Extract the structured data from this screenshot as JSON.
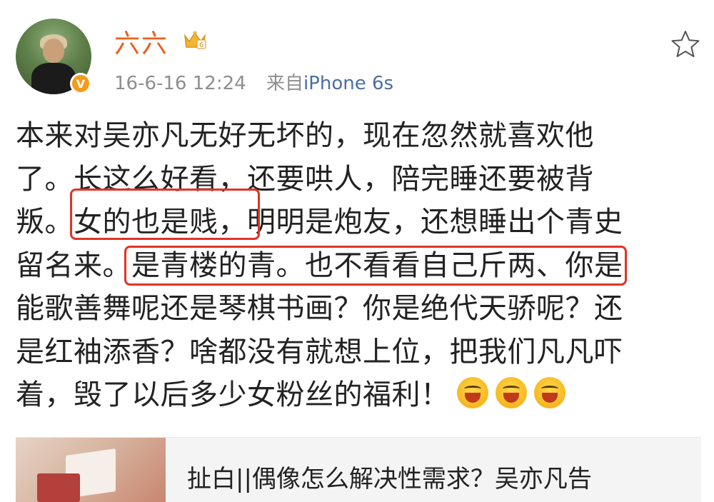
{
  "post_header": {
    "username": "六六",
    "timestamp": "16-6-16 12:24",
    "source_prefix": "来自",
    "device": "iPhone 6s",
    "verified_badge": "V",
    "crown_level": "6"
  },
  "post": {
    "lines": [
      "本来对吴亦凡无好无坏的，现在忽然就喜欢他",
      "了。长这么好看，还要哄人，陪完睡还要被背",
      "叛。女的也是贱，明明是炮友，还想睡出个青史",
      "留名来。是青楼的青。也不看看自己斤两、你是",
      "能歌善舞呢还是琴棋书画？你是绝代天骄呢？还",
      "是红袖添香？啥都没有就想上位，把我们凡凡吓",
      "着，毁了以后多少女粉丝的福利！"
    ],
    "emojis": [
      "laughing-emoji",
      "laughing-emoji",
      "laughing-emoji"
    ],
    "highlight_color": "#e03424"
  },
  "link_card": {
    "title": "扯白||偶像怎么解决性需求？吴亦凡告"
  },
  "colors": {
    "username": "#e8611f",
    "meta": "#8e8e8e",
    "device": "#4b6ea3"
  }
}
